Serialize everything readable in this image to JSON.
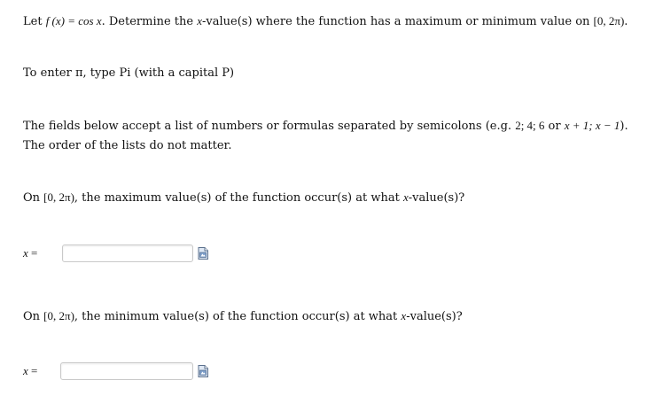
{
  "question": {
    "prompt_parts": {
      "lead": "Let ",
      "func": "f (x) = cos x",
      "mid": ". Determine the ",
      "var": "x",
      "tail": "-value(s) where the function has a maximum or minimum value on ",
      "interval": "[0, 2π)",
      "end": "."
    },
    "pi_hint": "To enter π, type Pi (with a capital P)",
    "instructions_line1_parts": {
      "text": "The fields below accept a list of numbers or formulas separated by semicolons (e.g. ",
      "example": "2;  4;  6",
      "or": " or ",
      "example2": "x + 1;  x − 1",
      "close": ")."
    },
    "instructions_line2": "The order of the lists do not matter.",
    "max_question_parts": {
      "lead": "On ",
      "interval": "[0, 2π)",
      "mid": ", the maximum value(s) of the function occur(s) at what ",
      "var": "x",
      "tail": "-value(s)?"
    },
    "min_question_parts": {
      "lead": "On ",
      "interval": "[0, 2π)",
      "mid": ", the minimum value(s) of the function occur(s) at what ",
      "var": "x",
      "tail": "-value(s)?"
    }
  },
  "answers": {
    "max": {
      "label_var": "x",
      "label_eq": " =",
      "value": ""
    },
    "min": {
      "label_var": "x",
      "label_eq": " =",
      "value": ""
    }
  },
  "icons": {
    "preview": "preview-icon"
  }
}
